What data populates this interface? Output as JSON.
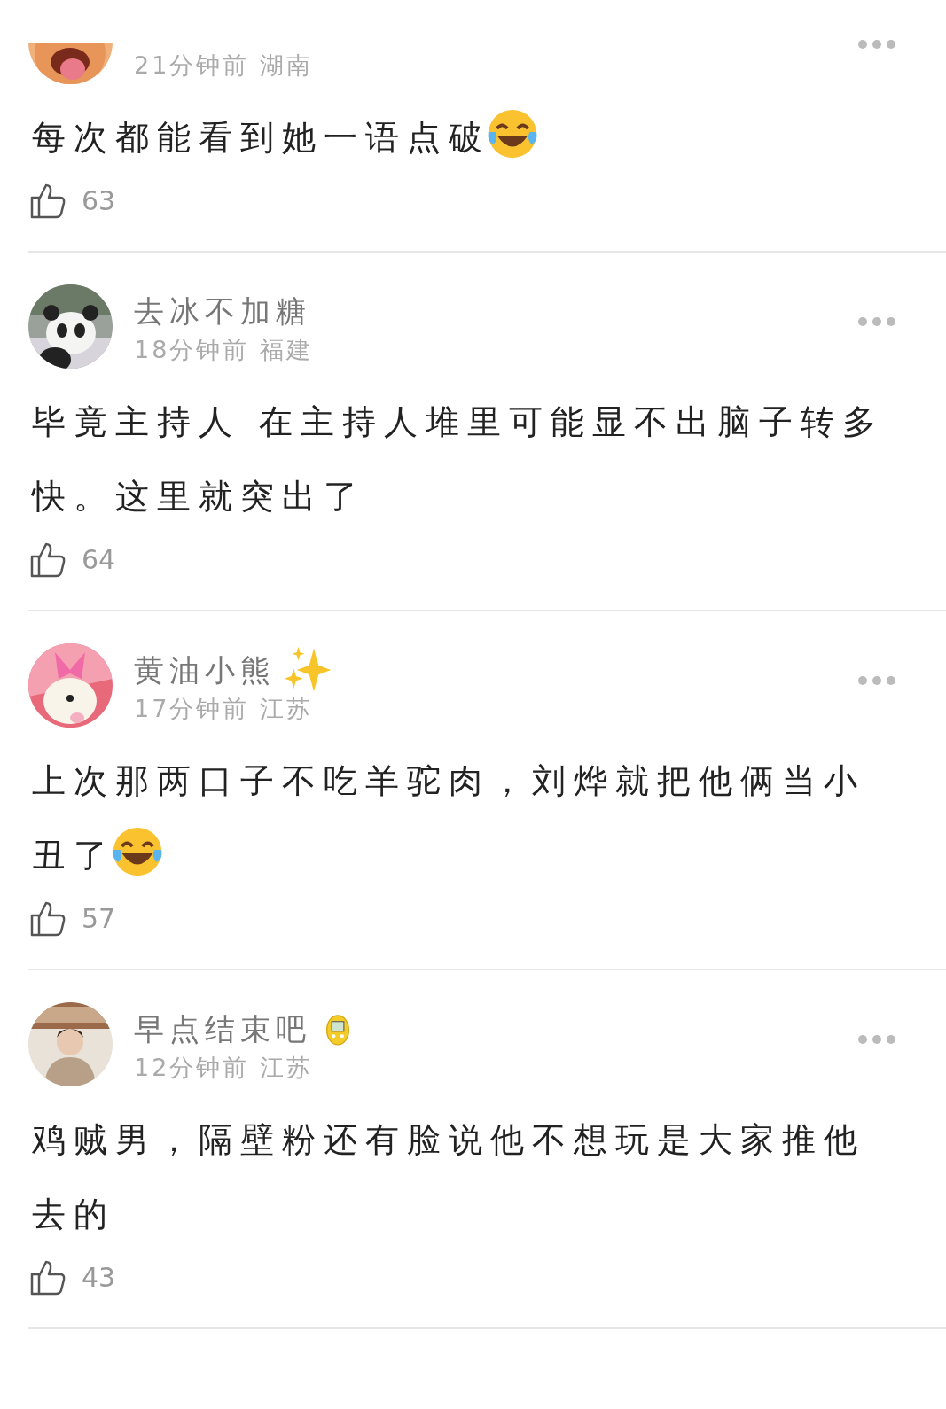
{
  "comments": [
    {
      "avatar": {
        "kind": "cartoon"
      },
      "meta": "21分钟前 湖南",
      "body": "每次都能看到她一语点破",
      "emoji": {
        "kind": "tears_of_joy"
      },
      "likes": "63"
    },
    {
      "avatar": {
        "kind": "panda"
      },
      "name": "去冰不加糖",
      "meta": "18分钟前 福建",
      "body": "毕竟主持人 在主持人堆里可能显不出脑子转多快。这里就突出了",
      "likes": "64"
    },
    {
      "avatar": {
        "kind": "bear"
      },
      "name": "黄油小熊",
      "badge": {
        "kind": "sparkles"
      },
      "meta": "17分钟前 江苏",
      "body": "上次那两口子不吃羊驼肉，刘烨就把他俩当小丑了",
      "emoji": {
        "kind": "tears_of_joy"
      },
      "likes": "57"
    },
    {
      "avatar": {
        "kind": "person"
      },
      "name": "早点结束吧",
      "badge": {
        "kind": "toy"
      },
      "meta": "12分钟前 江苏",
      "body": "鸡贼男，隔壁粉还有脸说他不想玩是大家推他去的",
      "likes": "43"
    }
  ]
}
